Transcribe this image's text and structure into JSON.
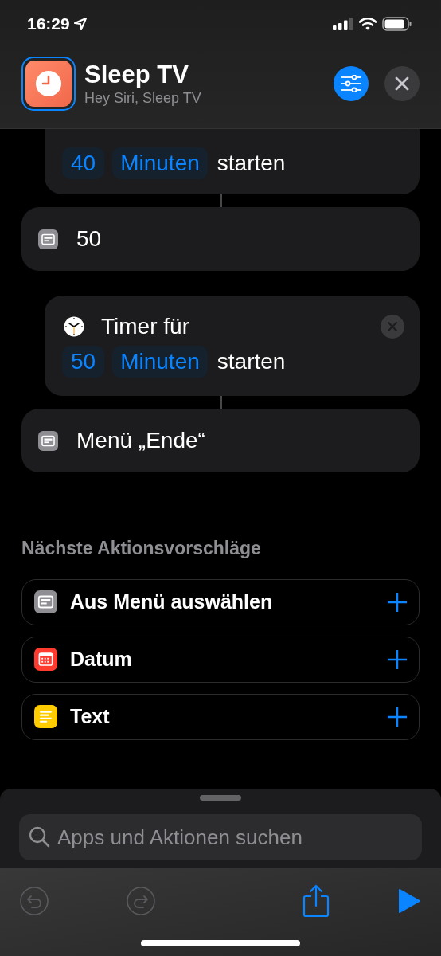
{
  "status_bar": {
    "time": "16:29"
  },
  "header": {
    "title": "Sleep TV",
    "subtitle": "Hey Siri, Sleep TV"
  },
  "actions": [
    {
      "kind": "timer",
      "amount": "40",
      "unit": "Minuten",
      "verb": "starten"
    },
    {
      "kind": "menu_item",
      "label": "50"
    },
    {
      "kind": "timer",
      "title": "Timer für",
      "amount": "50",
      "unit": "Minuten",
      "verb": "starten"
    },
    {
      "kind": "menu_end",
      "label": "Menü „Ende“"
    }
  ],
  "suggestions": {
    "heading": "Nächste Aktionsvorschläge",
    "items": [
      {
        "kind": "menu",
        "label": "Aus Menü auswählen",
        "color": "#8e8e93"
      },
      {
        "kind": "date",
        "label": "Datum",
        "color": "#ff3b30"
      },
      {
        "kind": "text",
        "label": "Text",
        "color": "#ffcc00"
      }
    ]
  },
  "search": {
    "placeholder": "Apps und Aktionen suchen"
  },
  "toolbar": [
    {
      "kind": "undo",
      "disabled": true
    },
    {
      "kind": "redo",
      "disabled": true
    },
    {
      "kind": "share",
      "disabled": false
    },
    {
      "kind": "run",
      "disabled": false
    }
  ]
}
